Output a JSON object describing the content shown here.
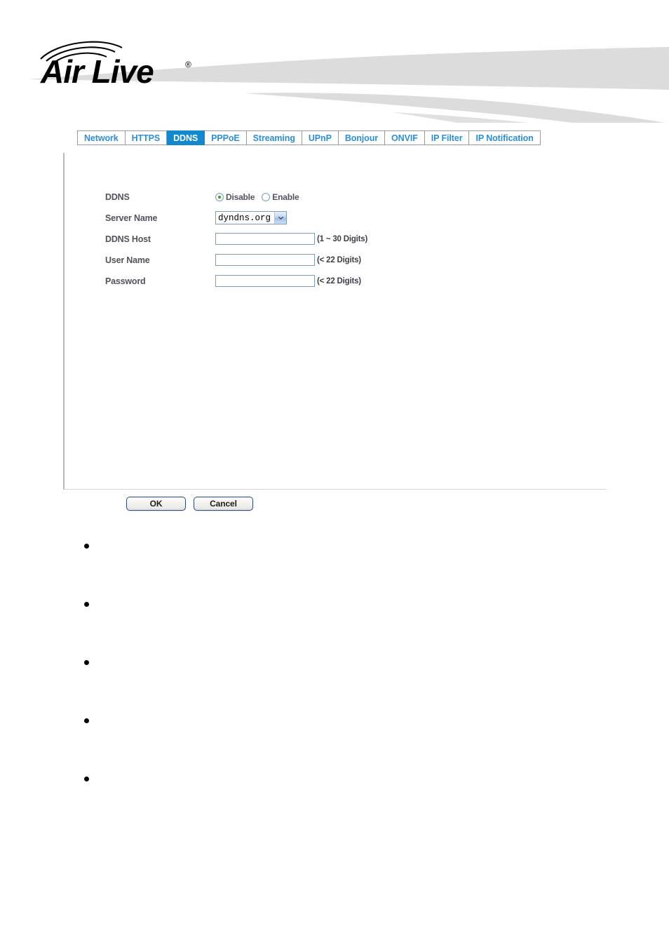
{
  "brand": {
    "logo_text": "Air Live",
    "logo_trademark": "®",
    "logo_icon": "signal-arcs-icon"
  },
  "tabs": [
    {
      "label": "Network",
      "active": false
    },
    {
      "label": "HTTPS",
      "active": false
    },
    {
      "label": "DDNS",
      "active": true
    },
    {
      "label": "PPPoE",
      "active": false
    },
    {
      "label": "Streaming",
      "active": false
    },
    {
      "label": "UPnP",
      "active": false
    },
    {
      "label": "Bonjour",
      "active": false
    },
    {
      "label": "ONVIF",
      "active": false
    },
    {
      "label": "IP Filter",
      "active": false
    },
    {
      "label": "IP Notification",
      "active": false
    }
  ],
  "form": {
    "ddns": {
      "label": "DDNS",
      "options": [
        {
          "label": "Disable",
          "selected": true
        },
        {
          "label": "Enable",
          "selected": false
        }
      ]
    },
    "server_name": {
      "label": "Server Name",
      "value": "dyndns.org",
      "arrow_icon": "chevron-down-icon"
    },
    "ddns_host": {
      "label": "DDNS Host",
      "value": "",
      "placeholder": "",
      "hint": "(1 ~ 30 Digits)"
    },
    "user_name": {
      "label": "User Name",
      "value": "",
      "placeholder": "",
      "hint": "(< 22 Digits)"
    },
    "password": {
      "label": "Password",
      "value": "",
      "placeholder": "",
      "hint": "(< 22 Digits)"
    }
  },
  "actions": {
    "ok_label": "OK",
    "cancel_label": "Cancel"
  },
  "notes": [
    {
      "text": ""
    },
    {
      "text": ""
    },
    {
      "text": ""
    },
    {
      "text": ""
    },
    {
      "text": ""
    }
  ],
  "colors": {
    "tab_text": "#2f8ed6",
    "tab_active_bg": "#1288ce",
    "label_text": "#53535b",
    "radio_selected_dot": "#2e9b2e",
    "swoosh": "#dddddd"
  }
}
